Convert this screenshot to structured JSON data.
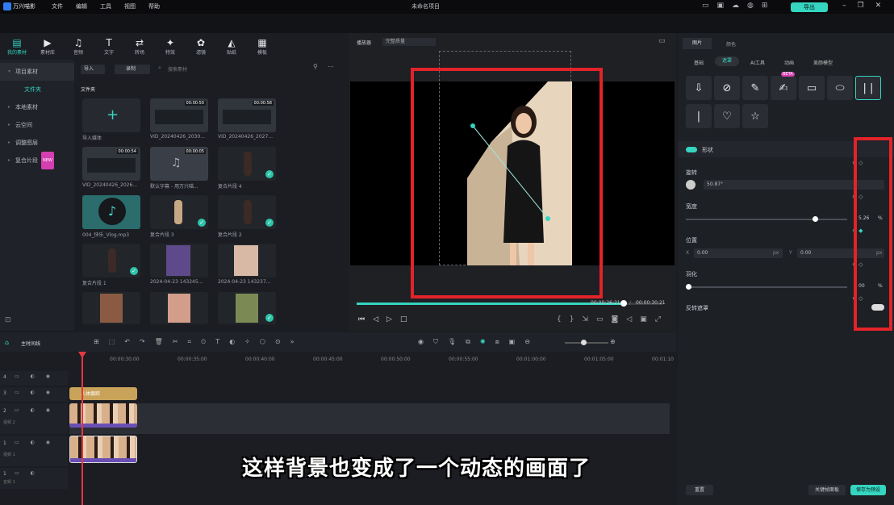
{
  "app": {
    "name": "万兴喵影",
    "project_title": "未命名项目",
    "export_label": "导出"
  },
  "menu": [
    "文件",
    "编辑",
    "工具",
    "视图",
    "帮助"
  ],
  "toolbar": [
    {
      "icon": "media-icon",
      "label": "我的素材"
    },
    {
      "icon": "library-icon",
      "label": "素材库"
    },
    {
      "icon": "audio-icon",
      "label": "音频"
    },
    {
      "icon": "text-icon",
      "label": "文字"
    },
    {
      "icon": "transition-icon",
      "label": "转场"
    },
    {
      "icon": "effects-icon",
      "label": "特效"
    },
    {
      "icon": "filter-icon",
      "label": "滤镜"
    },
    {
      "icon": "sticker-icon",
      "label": "贴纸"
    },
    {
      "icon": "template-icon",
      "label": "模板"
    }
  ],
  "sidebar": {
    "items": [
      "项目素材",
      "文件夹",
      "本地素材",
      "云空间",
      "调整图层",
      "复合片段"
    ],
    "new_badge": "NEW"
  },
  "media": {
    "import_label": "导入",
    "record_label": "录制",
    "search_placeholder": "搜索素材",
    "folder_label": "文件夹",
    "items": [
      {
        "name": "导入媒体",
        "duration": ""
      },
      {
        "name": "VID_20240426_2030...",
        "duration": "00:00:50"
      },
      {
        "name": "VID_20240426_2027...",
        "duration": "00:00:58"
      },
      {
        "name": "VID_20240426_2026...",
        "duration": "00:00:54"
      },
      {
        "name": "默认字幕 - 用万兴喵...",
        "duration": "00:00:05"
      },
      {
        "name": "复合片段 4",
        "duration": ""
      },
      {
        "name": "004_快乐_Vlog.mp3",
        "duration": ""
      },
      {
        "name": "复合片段 3",
        "duration": ""
      },
      {
        "name": "复合片段 2",
        "duration": ""
      },
      {
        "name": "复合片段 1",
        "duration": ""
      },
      {
        "name": "2024-04-23 143245...",
        "duration": ""
      },
      {
        "name": "2024-04-23 143237...",
        "duration": ""
      }
    ]
  },
  "preview": {
    "player_label": "播放器",
    "quality_label": "完整质量",
    "current_time": "00:00:26:21",
    "separator": "/",
    "total_time": "00:00:30:21",
    "progress": 0.87
  },
  "inspector": {
    "tabs": [
      "图片",
      "颜色"
    ],
    "subtabs": [
      "基础",
      "遮罩",
      "AI工具",
      "动画",
      "美颜模型"
    ],
    "beta_badge": "BETA",
    "mask_label": "形状",
    "rotate_label": "旋转",
    "rotate_value": "50.87°",
    "width_label": "宽度",
    "width_value": "5.26",
    "width_unit": "%",
    "width_fraction": 0.8,
    "position_label": "位置",
    "pos_x_label": "X",
    "pos_x": "0.00",
    "pos_y_label": "Y",
    "pos_y": "0.00",
    "px_unit": "px",
    "feather_label": "羽化",
    "feather_value": "00",
    "feather_unit": "%",
    "invert_label": "反转遮罩",
    "reset_label": "重置",
    "keyframe_label": "关键帧面板",
    "save_label": "保存为预设"
  },
  "timeline": {
    "track_label": "主时间线",
    "ticks": [
      "00:00:30:00",
      "00:00:35:00",
      "00:00:40:00",
      "00:00:45:00",
      "00:00:50:00",
      "00:00:55:00",
      "00:01:00:00",
      "00:01:05:00",
      "00:01:10"
    ],
    "tracks": [
      {
        "label": "4",
        "name": ""
      },
      {
        "label": "3",
        "name": ""
      },
      {
        "label": "2",
        "name": "视频 2"
      },
      {
        "label": "1",
        "name": "视频 1"
      },
      {
        "label": "1",
        "name": "音频 1"
      }
    ],
    "text_clip": "人体跟踪"
  },
  "subtitle": "这样背景也变成了一个动态的画面了",
  "colors": {
    "accent": "#35d5c0",
    "highlight_red": "#e2232a",
    "panel": "#1d2025"
  }
}
